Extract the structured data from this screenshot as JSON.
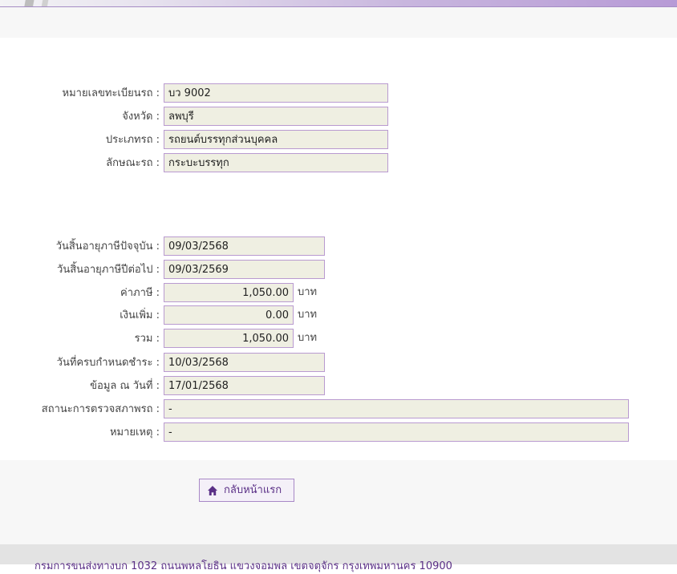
{
  "vehicle": {
    "plate_label": "หมายเลขทะเบียนรถ :",
    "plate_value": "บว 9002",
    "province_label": "จังหวัด :",
    "province_value": "ลพบุรี",
    "type_label": "ประเภทรถ :",
    "type_value": "รถยนต์บรรทุกส่วนบุคคล",
    "style_label": "ลักษณะรถ :",
    "style_value": "กระบะบรรทุก"
  },
  "tax": {
    "current_expiry_label": "วันสิ้นอายุภาษีปัจจุบัน :",
    "current_expiry_value": "09/03/2568",
    "next_expiry_label": "วันสิ้นอายุภาษีปีต่อไป :",
    "next_expiry_value": "09/03/2569",
    "tax_label": "ค่าภาษี :",
    "tax_value": "1,050.00",
    "surcharge_label": "เงินเพิ่ม :",
    "surcharge_value": "0.00",
    "total_label": "รวม :",
    "total_value": "1,050.00",
    "unit": "บาท",
    "due_date_label": "วันที่ครบกำหนดชำระ :",
    "due_date_value": "10/03/2568",
    "data_as_of_label": "ข้อมูล ณ วันที่ :",
    "data_as_of_value": "17/01/2568",
    "inspection_status_label": "สถานะการตรวจสภาพรถ :",
    "inspection_status_value": "-",
    "remark_label": "หมายเหตุ :",
    "remark_value": "-"
  },
  "actions": {
    "home_label": "กลับหน้าแรก",
    "home_icon": "home-icon"
  },
  "footer": {
    "address": "กรมการขนส่งทางบก 1032 ถนนพหลโยธิน แขวงจอมพล เขตจตุจักร กรุงเทพมหานคร 10900"
  },
  "colors": {
    "field_bg": "#efefe2",
    "field_border": "#b99ad0",
    "accent": "#5a2f86"
  }
}
